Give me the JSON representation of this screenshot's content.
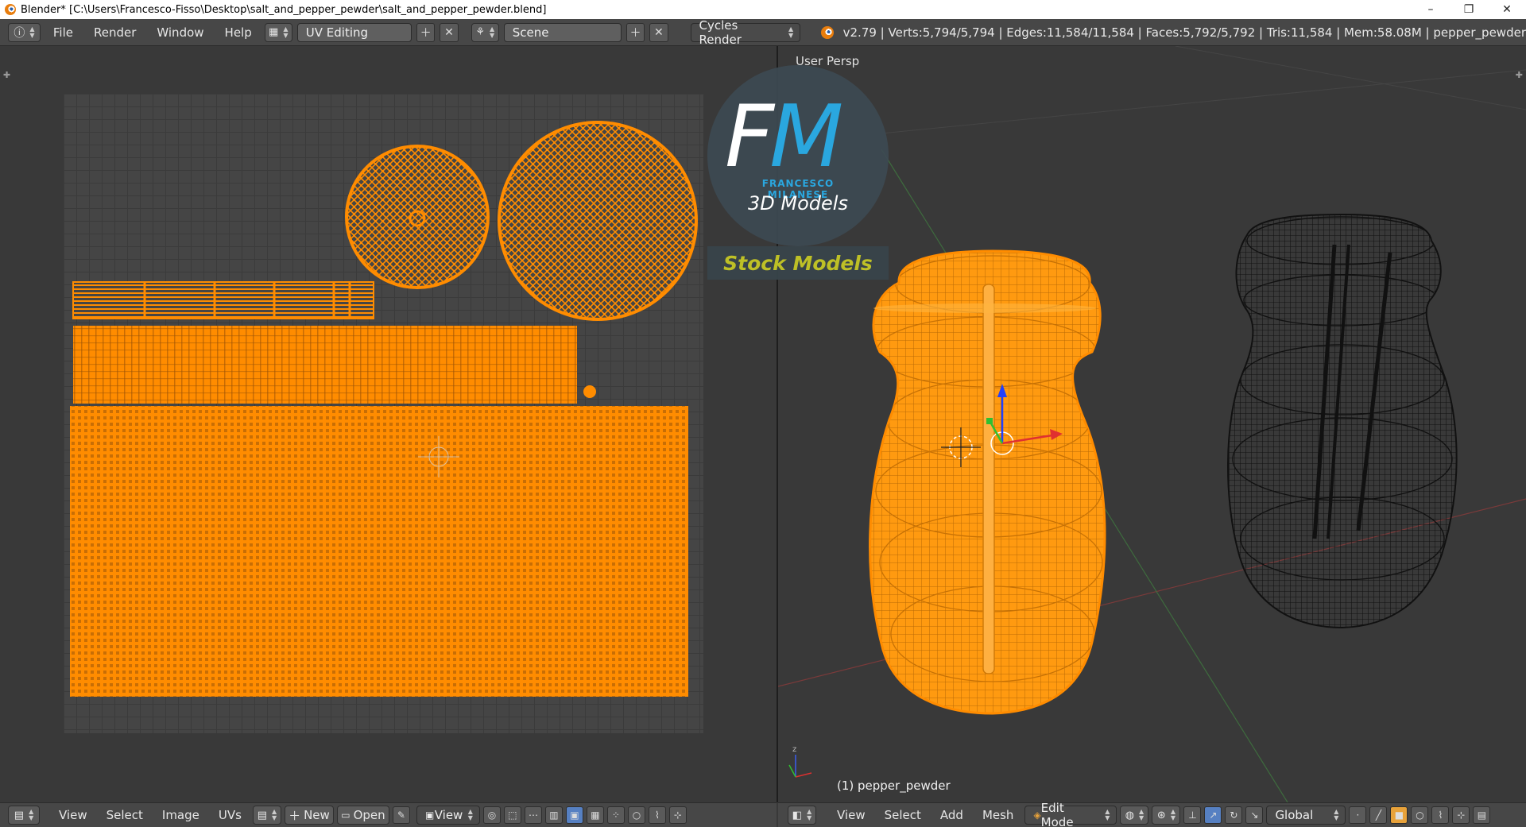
{
  "window": {
    "title": "Blender* [C:\\Users\\Francesco-Fisso\\Desktop\\salt_and_pepper_pewder\\salt_and_pepper_pewder.blend]",
    "minimize": "–",
    "maximize": "❐",
    "close": "✕"
  },
  "info_header": {
    "menus": [
      "File",
      "Render",
      "Window",
      "Help"
    ],
    "screen_layout": "UV Editing",
    "scene": "Scene",
    "render_engine": "Cycles Render",
    "stats": "v2.79 | Verts:5,794/5,794 | Edges:11,584/11,584 | Faces:5,792/5,792 | Tris:11,584 | Mem:58.08M | pepper_pewder"
  },
  "viewport": {
    "view_label": "User Persp",
    "object_label": "(1) pepper_pewder"
  },
  "logo": {
    "initial_f": "F",
    "initial_m": "M",
    "brand": "FRANCESCO MILANESE",
    "tagline": "3D Models",
    "banner": "Stock Models"
  },
  "uv_footer": {
    "menus": [
      "View",
      "Select",
      "Image",
      "UVs"
    ],
    "new_label": "New",
    "open_label": "Open",
    "view_label": "View"
  },
  "viewport_footer": {
    "menus": [
      "View",
      "Select",
      "Add",
      "Mesh"
    ],
    "mode": "Edit Mode",
    "orientation": "Global"
  },
  "colors": {
    "selection_orange": "#ff8c00",
    "wire_black": "#111111",
    "logo_blue": "#2aa7df",
    "logo_yellow": "#c6c825"
  }
}
